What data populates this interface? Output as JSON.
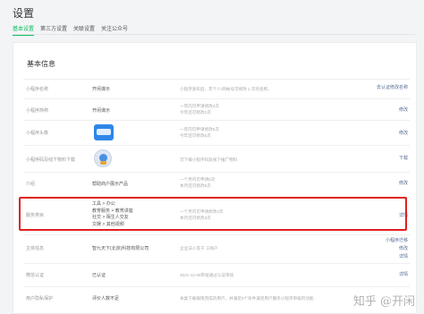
{
  "page": {
    "title": "设置"
  },
  "tabs": [
    {
      "label": "基本设置",
      "active": true
    },
    {
      "label": "第三方设置",
      "active": false
    },
    {
      "label": "关联设置",
      "active": false
    },
    {
      "label": "关注公众号",
      "active": false
    }
  ],
  "section": {
    "title": "基本信息"
  },
  "rows": {
    "name": {
      "label": "小程序名称",
      "value": "开闲谋示",
      "desc": "小程序发布后，年个人/商帐号可修改 1 次的名称。",
      "action": "去认证修改名称"
    },
    "intro": {
      "label": "小程序简称",
      "value": "开闲谋示",
      "desc": [
        "一年内可申请修改2次",
        "今年还可修改2次"
      ],
      "action": "修改"
    },
    "avatar": {
      "label": "小程序头像",
      "desc": [
        "一年内可申请修改5次",
        "今年还可修改5次"
      ],
      "action": "修改"
    },
    "qrcode": {
      "label": "小程序码及线下物料下载",
      "desc": "可下载小程序码及线下推广物料",
      "action": "下载"
    },
    "intro2": {
      "label": "介绍",
      "value": "帮助商户展示产品",
      "desc": [
        "一个月内可申请5次",
        "本月还可修改5次"
      ],
      "action": "修改"
    },
    "category": {
      "label": "服务类目",
      "items": [
        "工具 > 办公",
        "教育服务 > 教育讲座",
        "社交 > 陌生人交友",
        "文娱 > 其他视频"
      ],
      "desc": [
        "一个月内可申请修改3次",
        "本月还可修改3次"
      ],
      "action": "详情"
    },
    "subject": {
      "label": "主体信息",
      "value": "智九天下(北京)科技有限公司",
      "desc": "企业法人等于 工商户",
      "actions": [
        "小程序迁移",
        "修改",
        "详情"
      ]
    },
    "verify": {
      "label": "微信认证",
      "value": "已认证",
      "desc": "2021-12-08审核通过认证审核",
      "action": "详情"
    },
    "privacy": {
      "label": "用户隐私保护",
      "value": "评价人数不足",
      "desc": "本类下载报限完成的用户，并满足3个条件满足用户服务小程序审核的功能",
      "action": ""
    }
  },
  "watermark": {
    "text": "知乎 @开闲"
  },
  "colors": {
    "accent": "#07c160",
    "link": "#576b95",
    "highlight": "#e02020"
  }
}
